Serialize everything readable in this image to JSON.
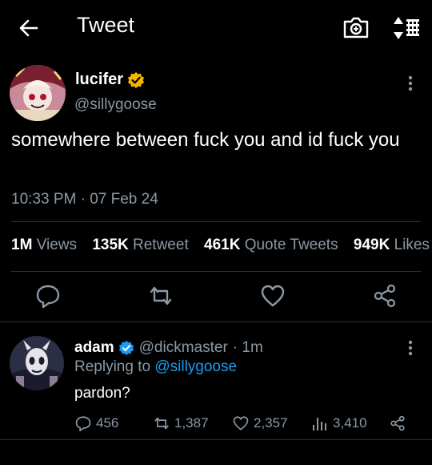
{
  "header": {
    "title": "Tweet",
    "icons": [
      "back-arrow-icon",
      "camera-icon",
      "sort-icon"
    ]
  },
  "tweet": {
    "author_name": "lucifer",
    "author_handle": "@sillygoose",
    "verified_color": "#f4b400",
    "text": "somewhere between fuck you and id fuck you",
    "timestamp": "10:33 PM · 07 Feb 24",
    "stats": [
      {
        "value": "1M",
        "label": "Views"
      },
      {
        "value": "135K",
        "label": "Retweet"
      },
      {
        "value": "461K",
        "label": "Quote Tweets"
      },
      {
        "value": "949K",
        "label": "Likes"
      }
    ],
    "actions": [
      "reply-icon",
      "retweet-icon",
      "like-icon",
      "share-icon"
    ]
  },
  "reply": {
    "author_name": "adam",
    "author_handle": "@dickmaster",
    "time": "· 1m",
    "verified_color": "#1d9bf0",
    "replying_label": "Replying to",
    "replying_handle": "@sillygoose",
    "text": "pardon?",
    "counts": {
      "replies": "456",
      "retweets": "1,387",
      "likes": "2,357",
      "views": "3,410"
    }
  },
  "colors": {
    "background": "#000000",
    "muted": "#8b98a5",
    "link": "#1d9bf0",
    "divider": "#2f3336"
  }
}
